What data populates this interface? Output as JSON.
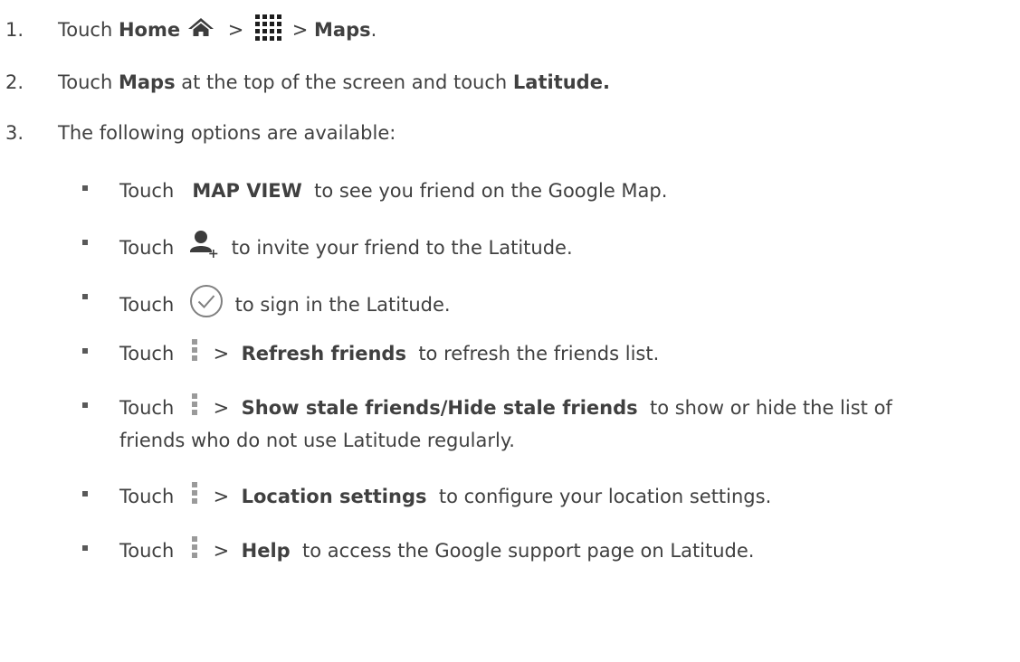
{
  "steps": [
    {
      "number": "1.",
      "touch": "Touch",
      "home": "Home",
      "sep1": " > ",
      "sep2": " > ",
      "maps": "Maps",
      "end": "."
    },
    {
      "number": "2.",
      "touch": "Touch",
      "maps": "Maps",
      "middle": " at the top of the screen and touch ",
      "latitude": "Latitude."
    },
    {
      "number": "3.",
      "text": "The following options are available:"
    }
  ],
  "options": [
    {
      "touch": "Touch",
      "bold": "MAP VIEW",
      "text": " to see you friend on the Google Map."
    },
    {
      "touch": "Touch",
      "text": "to invite your friend to the Latitude.",
      "icon": "add-person-icon"
    },
    {
      "touch": "Touch",
      "text": "to sign in the Latitude.",
      "icon": "check-circle-icon"
    },
    {
      "touch": "Touch",
      "sep": "> ",
      "bold": "Refresh friends",
      "text": " to refresh the friends list.",
      "icon": "menu-icon"
    },
    {
      "touch": "Touch",
      "sep": "> ",
      "bold": "Show stale friends/Hide stale friends",
      "text": " to show or hide the list of",
      "cont": "friends who do not use Latitude regularly.",
      "icon": "menu-icon"
    },
    {
      "touch": "Touch",
      "sep": "> ",
      "bold": "Location settings",
      "text": " to configure your location settings.",
      "icon": "menu-icon"
    },
    {
      "touch": "Touch",
      "sep": "> ",
      "bold": "Help",
      "text": " to access the Google support page on Latitude.",
      "icon": "menu-icon"
    }
  ],
  "icons": {
    "home": "home-icon",
    "apps": "apps-icon"
  },
  "colors": {
    "text": "#404040",
    "icon": "#3c3c3c",
    "menu": "#9a9a9a"
  }
}
